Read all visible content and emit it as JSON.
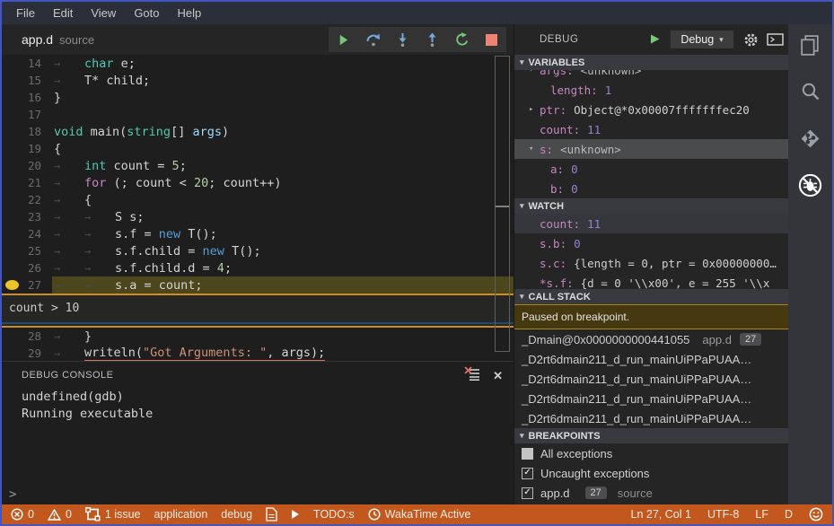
{
  "menu": {
    "items": [
      "File",
      "Edit",
      "View",
      "Goto",
      "Help"
    ]
  },
  "tab": {
    "file": "app.d",
    "type": "source"
  },
  "debug_toolbar": {
    "buttons": [
      {
        "name": "continue-button",
        "icon": "continue-icon"
      },
      {
        "name": "step-over-button",
        "icon": "step-over-icon"
      },
      {
        "name": "step-into-button",
        "icon": "step-into-icon"
      },
      {
        "name": "step-out-button",
        "icon": "step-out-icon"
      },
      {
        "name": "restart-button",
        "icon": "restart-icon"
      },
      {
        "name": "stop-button",
        "icon": "stop-icon"
      }
    ]
  },
  "editor": {
    "breakpoint": {
      "line": 27,
      "condition": "count > 10"
    },
    "lines": [
      {
        "num": 14,
        "indent": 1,
        "tokens": [
          [
            "kw",
            "char"
          ],
          [
            "pl",
            " e;"
          ]
        ]
      },
      {
        "num": 15,
        "indent": 1,
        "tokens": [
          [
            "pl",
            "T* child;"
          ]
        ]
      },
      {
        "num": 16,
        "indent": 0,
        "tokens": [
          [
            "pl",
            "}"
          ]
        ]
      },
      {
        "num": 17,
        "indent": 0,
        "tokens": []
      },
      {
        "num": 18,
        "indent": 0,
        "tokens": [
          [
            "kw",
            "void"
          ],
          [
            "pl",
            " main("
          ],
          [
            "kw",
            "string"
          ],
          [
            "pl",
            "[] "
          ],
          [
            "id",
            "args"
          ],
          [
            "pl",
            ")"
          ]
        ]
      },
      {
        "num": 19,
        "indent": 0,
        "tokens": [
          [
            "pl",
            "{"
          ]
        ]
      },
      {
        "num": 20,
        "indent": 1,
        "tokens": [
          [
            "kw",
            "int"
          ],
          [
            "pl",
            " count = "
          ],
          [
            "num",
            "5"
          ],
          [
            "pl",
            ";"
          ]
        ]
      },
      {
        "num": 21,
        "indent": 1,
        "tokens": [
          [
            "ctrl",
            "for"
          ],
          [
            "pl",
            " (; count < "
          ],
          [
            "num",
            "20"
          ],
          [
            "pl",
            "; count++)"
          ]
        ]
      },
      {
        "num": 22,
        "indent": 1,
        "tokens": [
          [
            "pl",
            "{"
          ]
        ]
      },
      {
        "num": 23,
        "indent": 2,
        "tokens": [
          [
            "pl",
            "S s;"
          ]
        ]
      },
      {
        "num": 24,
        "indent": 2,
        "tokens": [
          [
            "pl",
            "s.f = "
          ],
          [
            "new",
            "new"
          ],
          [
            "pl",
            " T();"
          ]
        ]
      },
      {
        "num": 25,
        "indent": 2,
        "tokens": [
          [
            "pl",
            "s.f.child = "
          ],
          [
            "new",
            "new"
          ],
          [
            "pl",
            " T();"
          ]
        ]
      },
      {
        "num": 26,
        "indent": 2,
        "tokens": [
          [
            "pl",
            "s.f.child.d = "
          ],
          [
            "num",
            "4"
          ],
          [
            "pl",
            ";"
          ]
        ]
      },
      {
        "num": 27,
        "indent": 2,
        "tokens": [
          [
            "pl",
            "s.a = count;"
          ]
        ]
      },
      {
        "num": 28,
        "indent": 1,
        "tokens": [
          [
            "pl",
            "}"
          ]
        ]
      },
      {
        "num": 29,
        "indent": 1,
        "underline": true,
        "tokens": [
          [
            "pl",
            "writeln("
          ],
          [
            "str",
            "\"Got Arguments: \""
          ],
          [
            "pl",
            ", args);"
          ]
        ]
      }
    ]
  },
  "console": {
    "title": "DEBUG CONSOLE",
    "output": [
      "undefined(gdb)",
      "Running executable"
    ],
    "prompt": ">",
    "close_label": "✕"
  },
  "panel": {
    "title": "DEBUG",
    "profile": "Debug",
    "dropdown_chevron": "▾",
    "variables": {
      "title": "VARIABLES",
      "rows": [
        {
          "name": "args:",
          "value": "<unknown>",
          "vtype": "unknown",
          "twisty": "expanded"
        },
        {
          "name": "length:",
          "value": "1",
          "vtype": "num",
          "indent": 1
        },
        {
          "name": "ptr:",
          "value": "Object@*0x00007fffffffec20",
          "vtype": "plain",
          "twisty": "collapsed"
        },
        {
          "name": "count:",
          "value": "11",
          "vtype": "num"
        },
        {
          "name": "s:",
          "value": "<unknown>",
          "vtype": "unknown",
          "twisty": "expanded",
          "selected": true
        },
        {
          "name": "a:",
          "value": "0",
          "vtype": "num",
          "indent": 1
        },
        {
          "name": "b:",
          "value": "0",
          "vtype": "num",
          "indent": 1
        }
      ]
    },
    "watch": {
      "title": "WATCH",
      "rows": [
        {
          "name": "count:",
          "value": "11",
          "vtype": "num",
          "selected": true
        },
        {
          "name": "s.b:",
          "value": "0",
          "vtype": "num"
        },
        {
          "name": "s.c:",
          "value": "{length = 0, ptr = 0x00000000…",
          "vtype": "plain"
        },
        {
          "name": "*s.f:",
          "value": "{d = 0 '\\\\x00', e = 255 '\\\\x",
          "vtype": "plain"
        }
      ]
    },
    "call_stack": {
      "title": "CALL STACK",
      "status": "Paused on breakpoint.",
      "frames": [
        {
          "fn": "_Dmain@0x0000000000441055",
          "file": "app.d",
          "line": "27"
        },
        {
          "fn": "_D2rt6dmain211_d_run_mainUiPPaPUAA…"
        },
        {
          "fn": "_D2rt6dmain211_d_run_mainUiPPaPUAA…"
        },
        {
          "fn": "_D2rt6dmain211_d_run_mainUiPPaPUAA…"
        },
        {
          "fn": "_D2rt6dmain211_d_run_mainUiPPaPUAA…"
        }
      ]
    },
    "breakpoints": {
      "title": "BREAKPOINTS",
      "rows": [
        {
          "label": "All exceptions",
          "checked": false
        },
        {
          "label": "Uncaught exceptions",
          "checked": true
        },
        {
          "label": "app.d",
          "badge": "27",
          "suffix": "source",
          "checked": true
        }
      ]
    }
  },
  "activity_bar": {
    "items": [
      {
        "name": "files",
        "icon": "files-icon"
      },
      {
        "name": "search",
        "icon": "search-icon"
      },
      {
        "name": "source-control",
        "icon": "git-icon"
      },
      {
        "name": "debug",
        "icon": "debug-slash-icon",
        "active": true
      }
    ]
  },
  "status_bar": {
    "left": [
      {
        "icon": "error-icon",
        "text": "0"
      },
      {
        "icon": "warning-icon",
        "text": "0"
      },
      {
        "icon": "issues-icon",
        "text": "1 issue"
      },
      {
        "text": "application"
      },
      {
        "text": "debug"
      },
      {
        "icon": "file-icon"
      },
      {
        "icon": "play-icon"
      },
      {
        "text": "TODO:s"
      },
      {
        "icon": "clock-icon",
        "text": "WakaTime Active"
      }
    ],
    "right": [
      {
        "text": "Ln 27, Col 1"
      },
      {
        "text": "UTF-8"
      },
      {
        "text": "LF"
      },
      {
        "text": "D"
      },
      {
        "icon": "smiley-icon"
      }
    ]
  },
  "colors": {
    "window_border": "#4356c0",
    "status_bar": "#c2581e",
    "breakpoint": "#edc32a",
    "current_line": "#4c461c",
    "condition_border": "#cf8c1d",
    "stop_button": "#ee8373",
    "run_green": "#79c879",
    "step_blue": "#75a8dd"
  }
}
